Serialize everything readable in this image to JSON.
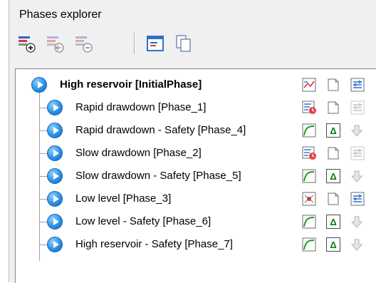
{
  "panel": {
    "title": "Phases explorer"
  },
  "toolbar": {
    "buttons": [
      {
        "icon": "add-phase-icon"
      },
      {
        "icon": "insert-phase-icon"
      },
      {
        "icon": "delete-phase-icon"
      },
      {
        "icon": "phase-window-icon"
      },
      {
        "icon": "copy-phase-icon"
      }
    ]
  },
  "tree": {
    "phases": [
      {
        "label": "High reservoir [InitialPhase]",
        "bold": true,
        "icons": [
          "steady-flow-icon",
          "page-icon",
          "settings-icon"
        ]
      },
      {
        "label": "Rapid drawdown [Phase_1]",
        "icons": [
          "transient-flow-icon",
          "page-icon",
          "settings-faint-icon"
        ]
      },
      {
        "label": "Rapid drawdown - Safety [Phase_4]",
        "icons": [
          "safety-curve-icon",
          "delta-icon",
          "arrow-down-faint-icon"
        ]
      },
      {
        "label": "Slow drawdown [Phase_2]",
        "icons": [
          "transient-flow-icon",
          "page-icon",
          "settings-faint-icon"
        ]
      },
      {
        "label": "Slow drawdown - Safety [Phase_5]",
        "icons": [
          "safety-curve-icon",
          "delta-icon",
          "arrow-down-faint-icon"
        ]
      },
      {
        "label": "Low level [Phase_3]",
        "icons": [
          "steady-state-icon",
          "page-icon",
          "settings-icon"
        ]
      },
      {
        "label": "Low level - Safety [Phase_6]",
        "icons": [
          "safety-curve-icon",
          "delta-icon",
          "arrow-down-faint-icon"
        ]
      },
      {
        "label": "High reservoir - Safety [Phase_7]",
        "icons": [
          "safety-curve-icon",
          "delta-icon",
          "arrow-down-faint-icon"
        ]
      }
    ],
    "delta_symbol": "Δ"
  }
}
